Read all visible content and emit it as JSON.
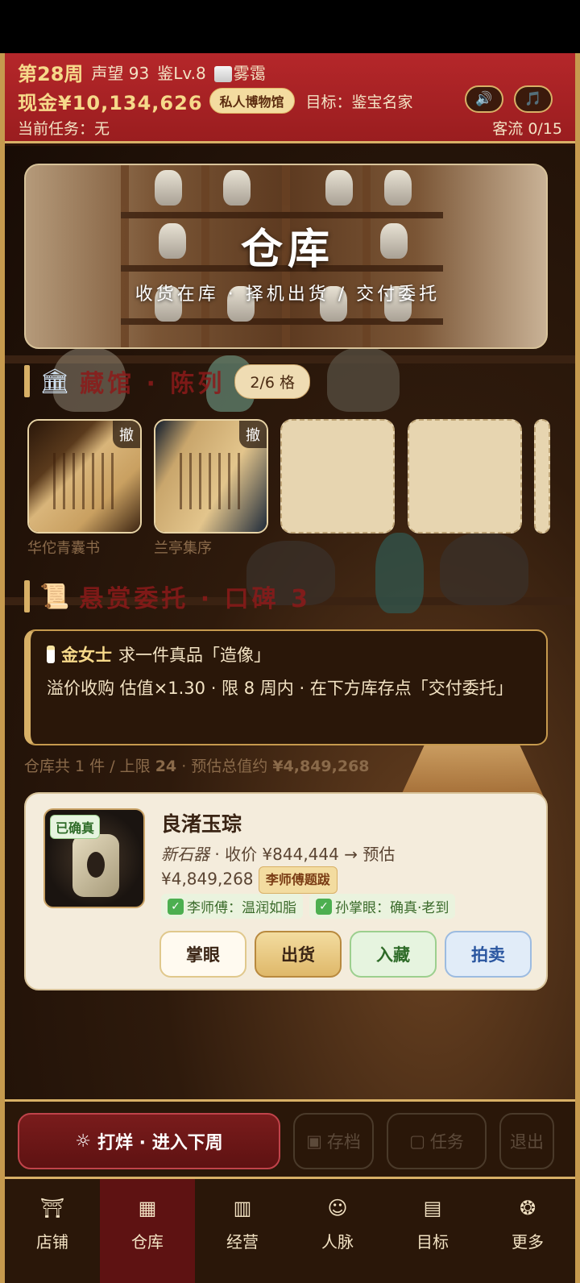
{
  "header": {
    "week": "第28周",
    "reputation": "声望 93",
    "appraisal_level": "鉴Lv.8",
    "weather": "雾霭",
    "cash": "现金¥10,134,626",
    "museum_label": "私人博物馆",
    "goal": "目标：鉴宝名家",
    "current_task": "当前任务：无",
    "customer_flow": "客流 0/15",
    "sound_icon": "🔊",
    "music_icon": "🎵"
  },
  "banner": {
    "title": "仓库",
    "subtitle": "收货在库 · 择机出货 / 交付委托"
  },
  "gallery": {
    "title": "藏馆 · 陈列",
    "slot_count": "2/6 格",
    "remove_label": "撤",
    "items": [
      {
        "name": "华佗青囊书"
      },
      {
        "name": "兰亭集序"
      }
    ]
  },
  "commission": {
    "title": "悬赏委托 · 口碑 3",
    "client": "金女士",
    "request": "求一件真品「造像」",
    "details": "溢价收购 估值×1.30 · 限 8 周内 · 在下方库存点「交付委托」"
  },
  "inventory_summary": {
    "count_text": "仓库共 1 件 / 上限 ",
    "limit": "24",
    "value_text": " · 预估总值约 ",
    "value": "¥4,849,268"
  },
  "item": {
    "verified_badge": "已确真",
    "name": "良渚玉琮",
    "era": "新石器",
    "price_text": " · 收价 ¥844,444 → 预估",
    "estimate": "¥4,849,268",
    "inscription": "李师傅题跋",
    "tags": [
      "李师傅：温润如脂",
      "孙掌眼：确真·老到"
    ],
    "actions": {
      "appraise": "掌眼",
      "sell": "出货",
      "collect": "入藏",
      "auction": "拍卖"
    }
  },
  "action_bar": {
    "next_week": "打烊 · 进入下周",
    "save": "存档",
    "tasks": "任务",
    "quit": "退出"
  },
  "tabs": [
    {
      "label": "店铺"
    },
    {
      "label": "仓库"
    },
    {
      "label": "经营"
    },
    {
      "label": "人脉"
    },
    {
      "label": "目标"
    },
    {
      "label": "更多"
    }
  ]
}
